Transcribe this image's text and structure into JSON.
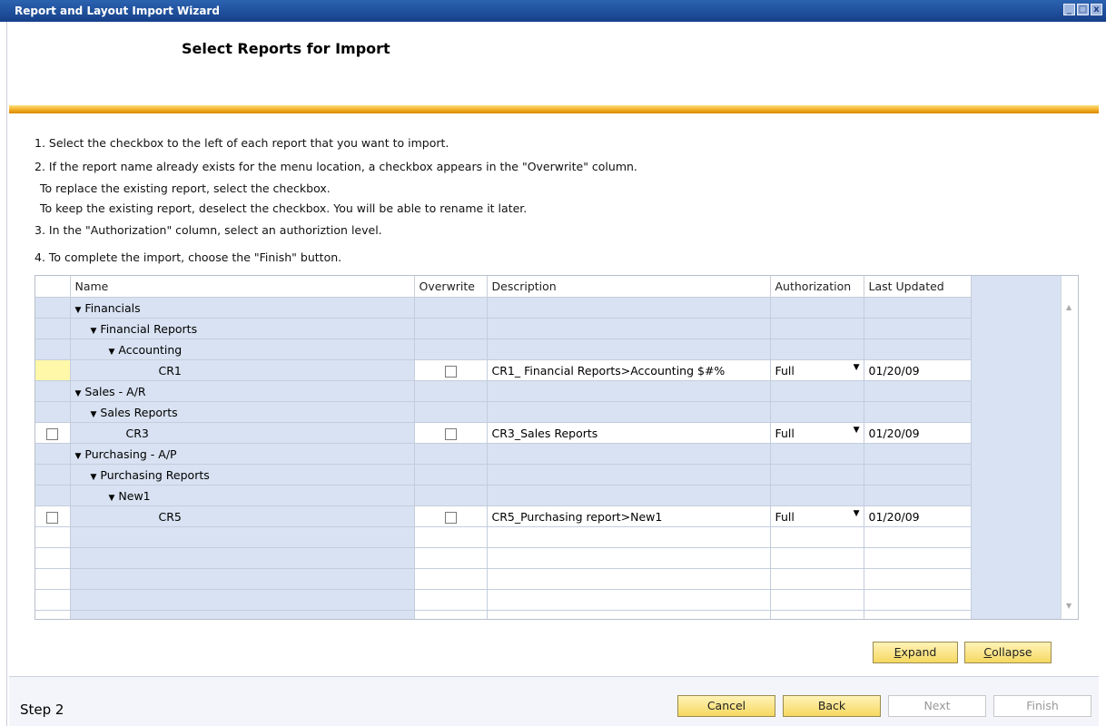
{
  "window": {
    "title": "Report and Layout Import Wizard"
  },
  "header": {
    "title": "Select Reports for Import"
  },
  "instructions": [
    "1. Select the checkbox to the left of each report that you want to import.",
    "2. If the report name already exists for the menu location, a checkbox appears in the \"Overwrite\" column.",
    "To replace the existing report, select the checkbox.",
    "To keep the existing report, deselect the checkbox. You will be able to rename it later.",
    "3. In the \"Authorization\" column, select an authoriztion level.",
    "4. To complete the import, choose the \"Finish\" button."
  ],
  "grid": {
    "columns": {
      "name": "Name",
      "overwrite": "Overwrite",
      "description": "Description",
      "authorization": "Authorization",
      "last_updated": "Last Updated"
    },
    "rows": [
      {
        "name": "Financials"
      },
      {
        "name": "Financial Reports"
      },
      {
        "name": "Accounting"
      },
      {
        "name": "CR1",
        "description": "CR1_ Financial Reports>Accounting $#%",
        "authorization": "Full",
        "last_updated": "01/20/09"
      },
      {
        "name": "Sales - A/R"
      },
      {
        "name": "Sales Reports"
      },
      {
        "name": "CR3",
        "description": "CR3_Sales Reports",
        "authorization": "Full",
        "last_updated": "01/20/09"
      },
      {
        "name": "Purchasing - A/P"
      },
      {
        "name": "Purchasing Reports"
      },
      {
        "name": "New1"
      },
      {
        "name": "CR5",
        "description": "CR5_Purchasing report>New1",
        "authorization": "Full",
        "last_updated": "01/20/09"
      }
    ]
  },
  "buttons": {
    "expand_pre": "",
    "expand_key": "E",
    "expand_post": "xpand",
    "collapse_pre": "",
    "collapse_key": "C",
    "collapse_post": "ollapse",
    "cancel": "Cancel",
    "back": "Back",
    "next": "Next",
    "finish": "Finish"
  },
  "footer": {
    "step": "Step 2"
  }
}
